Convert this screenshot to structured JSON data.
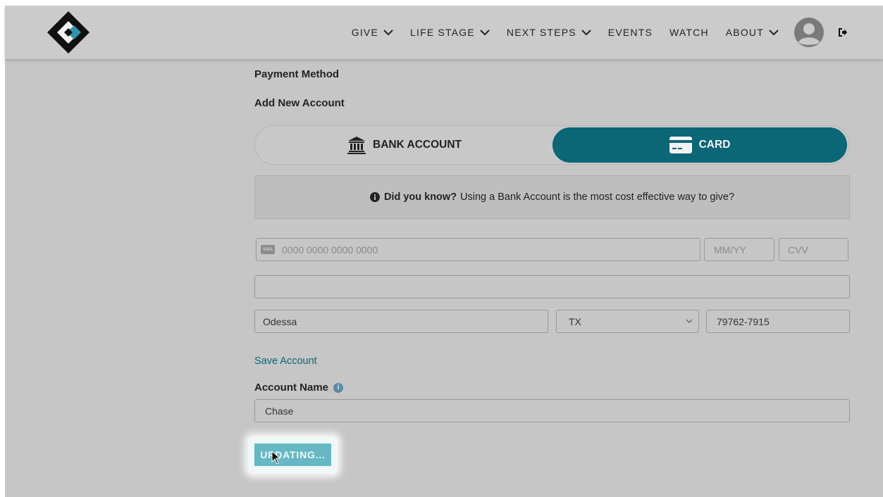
{
  "nav": {
    "items": [
      {
        "label": "GIVE",
        "dropdown": true
      },
      {
        "label": "LIFE STAGE",
        "dropdown": true
      },
      {
        "label": "NEXT STEPS",
        "dropdown": true
      },
      {
        "label": "EVENTS",
        "dropdown": false
      },
      {
        "label": "WATCH",
        "dropdown": false
      },
      {
        "label": "ABOUT",
        "dropdown": true
      }
    ]
  },
  "form": {
    "payment_method_label": "Payment Method",
    "add_new_account_label": "Add New Account",
    "toggle": {
      "bank_label": "BANK ACCOUNT",
      "card_label": "CARD",
      "selected": "CARD"
    },
    "notice": {
      "bold": "Did you know?",
      "text": "Using a Bank Account is the most cost effective way to give?"
    },
    "card_number_placeholder": "0000 0000 0000 0000",
    "card_brand_icon": "VISA",
    "expiry_placeholder": "MM/YY",
    "cvv_placeholder": "CVV",
    "address_value": "",
    "city_value": "Odessa",
    "state_value": "TX",
    "zip_value": "79762-7915",
    "save_account_link": "Save Account",
    "account_name_label": "Account Name",
    "account_name_value": "Chase",
    "submit_label": "UPDATING..."
  },
  "colors": {
    "accent": "#0b6675",
    "button": "#65b8c4",
    "background": "#c6c6c6"
  }
}
